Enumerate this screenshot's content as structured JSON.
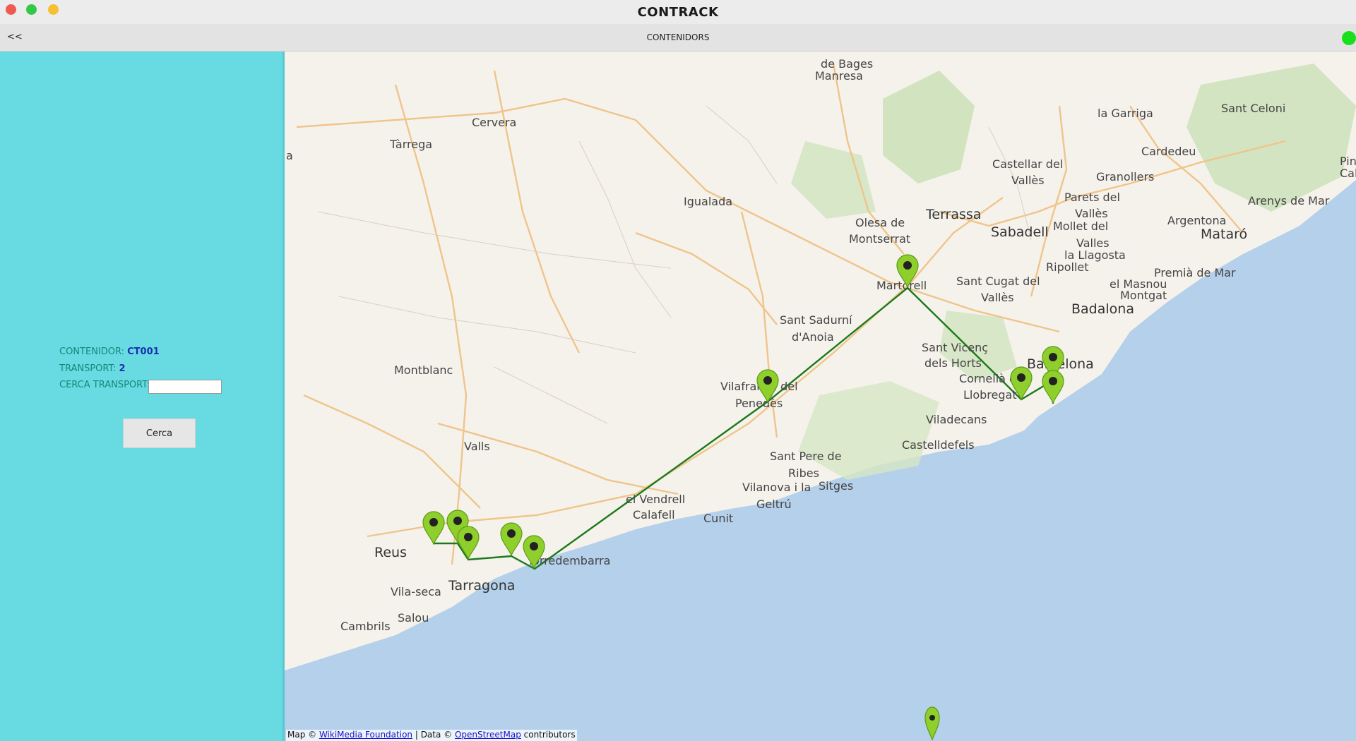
{
  "window": {
    "title": "CONTRACK",
    "controls": [
      "close",
      "minimize",
      "maximize"
    ]
  },
  "toolbar": {
    "back_label": "<<",
    "section_title": "CONTENIDORS",
    "status_color": "#19e01d"
  },
  "sidebar": {
    "background": "#68dbe2",
    "container_label": "CONTENIDOR: ",
    "container_value": "CT001",
    "transport_label": "TRANSPORT: ",
    "transport_value": "2",
    "search_label": "CERCA TRANSPORT: ",
    "search_value": "",
    "search_button": "Cerca"
  },
  "map": {
    "route_color": "#1a7a1a",
    "marker_color": "#8ecf2c",
    "place_names": [
      "de Bages",
      "Manresa",
      "Cervera",
      "Tàrrega",
      "Igualada",
      "la Garriga",
      "Sant Celoni",
      "Cardedeu",
      "Castellar del",
      "Vallès",
      "Granollers",
      "Terrassa",
      "Sabadell",
      "Parets del",
      "Vallès",
      "Mollet del",
      "Valles",
      "la Llagosta",
      "Ripollet",
      "Olesa de",
      "Montserrat",
      "Argentona",
      "Mataró",
      "Arenys de Mar",
      "Martorell",
      "Sant Cugat del",
      "Vallès",
      "Premià de Mar",
      "el Masnou",
      "Montgat",
      "Badalona",
      "Sant Sadurní",
      "d'Anoia",
      "Sant Vicenç",
      "dels Horts",
      "Barcelona",
      "Cornellà de",
      "Llobregat",
      "Montblanc",
      "Vilafranca del",
      "Penedès",
      "Valls",
      "Viladecans",
      "Castelldefels",
      "Sant Pere de",
      "Ribes",
      "Vilanova i la",
      "Geltrú",
      "Sitges",
      "el Vendrell",
      "Calafell",
      "Cunit",
      "Reus",
      "Torredembarra",
      "Vila-seca",
      "Tarragona",
      "Salou",
      "Cambrils",
      "Pin",
      "Cal",
      "a"
    ],
    "attribution": {
      "prefix": "Map © ",
      "link1": "WikiMedia Foundation",
      "middle": " | Data © ",
      "link2": "OpenStreetMap",
      "suffix": " contributors"
    }
  }
}
